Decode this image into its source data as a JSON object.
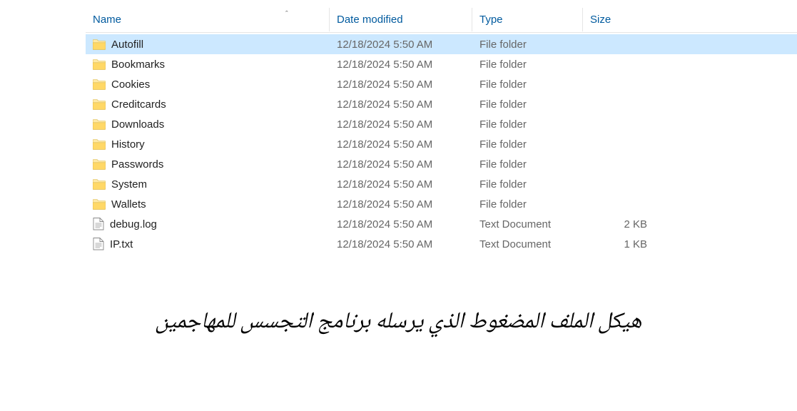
{
  "columns": {
    "name": "Name",
    "date": "Date modified",
    "type": "Type",
    "size": "Size"
  },
  "sort_indicator": "ˆ",
  "files": [
    {
      "name": "Autofill",
      "date": "12/18/2024 5:50 AM",
      "type": "File folder",
      "size": "",
      "icon": "folder",
      "selected": true
    },
    {
      "name": "Bookmarks",
      "date": "12/18/2024 5:50 AM",
      "type": "File folder",
      "size": "",
      "icon": "folder",
      "selected": false
    },
    {
      "name": "Cookies",
      "date": "12/18/2024 5:50 AM",
      "type": "File folder",
      "size": "",
      "icon": "folder",
      "selected": false
    },
    {
      "name": "Creditcards",
      "date": "12/18/2024 5:50 AM",
      "type": "File folder",
      "size": "",
      "icon": "folder",
      "selected": false
    },
    {
      "name": "Downloads",
      "date": "12/18/2024 5:50 AM",
      "type": "File folder",
      "size": "",
      "icon": "folder",
      "selected": false
    },
    {
      "name": "History",
      "date": "12/18/2024 5:50 AM",
      "type": "File folder",
      "size": "",
      "icon": "folder",
      "selected": false
    },
    {
      "name": "Passwords",
      "date": "12/18/2024 5:50 AM",
      "type": "File folder",
      "size": "",
      "icon": "folder",
      "selected": false
    },
    {
      "name": "System",
      "date": "12/18/2024 5:50 AM",
      "type": "File folder",
      "size": "",
      "icon": "folder",
      "selected": false
    },
    {
      "name": "Wallets",
      "date": "12/18/2024 5:50 AM",
      "type": "File folder",
      "size": "",
      "icon": "folder",
      "selected": false
    },
    {
      "name": "debug.log",
      "date": "12/18/2024 5:50 AM",
      "type": "Text Document",
      "size": "2 KB",
      "icon": "text",
      "selected": false
    },
    {
      "name": "IP.txt",
      "date": "12/18/2024 5:50 AM",
      "type": "Text Document",
      "size": "1 KB",
      "icon": "text",
      "selected": false
    }
  ],
  "caption": "هيكل الملف المضغوط الذي يرسله برنامج التجسس للمهاجمين"
}
